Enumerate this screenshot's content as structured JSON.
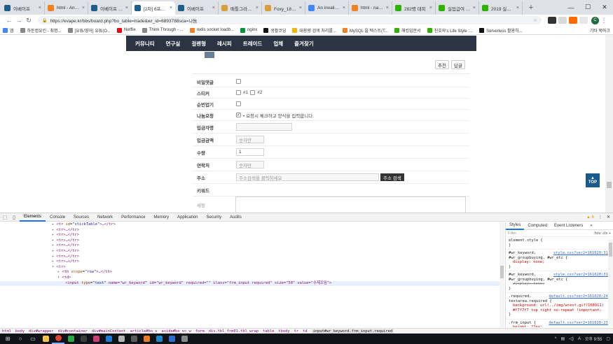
{
  "browser": {
    "tabs": [
      {
        "title": "이베이프",
        "color": "#1f5e8c",
        "active": false
      },
      {
        "title": "html - An in...",
        "color": "#f48024",
        "active": false
      },
      {
        "title": "이베이프 날...",
        "color": "#1f5e8c",
        "active": false
      },
      {
        "title": "[2차] 6프라...",
        "color": "#1f5e8c",
        "active": true
      },
      {
        "title": "이베이프",
        "color": "#1f5e8c",
        "active": false
      },
      {
        "title": "배틀그라운드",
        "color": "#d8a03c",
        "active": false
      },
      {
        "title": "Foxy_1881 의",
        "color": "#d8a03c",
        "active": false
      },
      {
        "title": "An invalid fo",
        "color": "#4285f4",
        "active": false
      },
      {
        "title": "html - name",
        "color": "#f48024",
        "active": false
      },
      {
        "title": "282명 대피",
        "color": "#2db400",
        "active": false
      },
      {
        "title": "실업급여 수...",
        "color": "#2db400",
        "active": false
      },
      {
        "title": "2019 실업급...",
        "color": "#2db400",
        "active": false
      }
    ],
    "new_tab": "+",
    "window_controls": [
      "—",
      "☐",
      "✕"
    ],
    "url": "https://evape.kr/bbs/board.php?bo_table=trade&wr_id=6893788sca=나눔",
    "profile_initial": "C",
    "bookmarks": [
      {
        "label": "앱",
        "color": "#4285f4"
      },
      {
        "label": "하둔컴유킨 - 최명...",
        "color": "#888888"
      },
      {
        "label": "[유튜/영어] 유튜(O...",
        "color": "#888888"
      },
      {
        "label": "Netflix",
        "color": "#e50914"
      },
      {
        "label": "Think Through - ...",
        "color": "#888888"
      },
      {
        "label": "redis socket loadb...",
        "color": "#f48024"
      },
      {
        "label": "nginx",
        "color": "#009639"
      },
      {
        "label": "생활코딩",
        "color": "#111111"
      },
      {
        "label": "대용량 검색 처리를...",
        "color": "#f4b400"
      },
      {
        "label": "MySQL 을 텍스트(T...",
        "color": "#f48024"
      },
      {
        "label": "해킹입문서",
        "color": "#2db400"
      },
      {
        "label": "친호와's Life Style :...",
        "color": "#2db400"
      },
      {
        "label": "Serverless 활용하...",
        "color": "#111111"
      }
    ],
    "bookmarks_other": "기타 북마크"
  },
  "site": {
    "nav": [
      "커뮤니티",
      "연구실",
      "걸렌형",
      "레시피",
      "트레이드",
      "업체",
      "즐겨찾기"
    ],
    "buttons": {
      "recommend": "추천",
      "reply": "답글"
    },
    "form": {
      "secret_comment": "비밀댓글",
      "sticker": "스티커",
      "sticker_opts": [
        "#1",
        "#2"
      ],
      "order": "순번업기",
      "share_request": "나눔요청",
      "share_note": "• 요청시 체크하고 양식을 입력합니다.",
      "depositor": "입금자명",
      "amount": "입금금액",
      "amount_ph": "숫자만",
      "qty": "수량",
      "qty_val": "1",
      "contact": "연락처",
      "contact_ph": "숫자만",
      "address": "주소",
      "address_ph": "주소검색을 클릭하세요",
      "address_btn": "주소 검색",
      "keyword": "키워드",
      "memo": "세팅"
    },
    "top_button": "TOP"
  },
  "devtools": {
    "tabs": [
      "Elements",
      "Console",
      "Sources",
      "Network",
      "Performance",
      "Memory",
      "Application",
      "Security",
      "Audits"
    ],
    "warnings": "▲ 6",
    "dom_lines": [
      {
        "indent": 4,
        "tri": "▸",
        "tag": "tr",
        "attr": "id",
        "val": "stickTable",
        "tail": ">…</tr>"
      },
      {
        "indent": 4,
        "tri": "▸",
        "tag": "tr",
        "attr": "",
        "val": "",
        "tail": ">…</tr>"
      },
      {
        "indent": 4,
        "tri": "▸",
        "tag": "tr",
        "attr": "",
        "val": "",
        "tail": ">…</tr>"
      },
      {
        "indent": 4,
        "tri": "▸",
        "tag": "tr",
        "attr": "",
        "val": "",
        "tail": ">…</tr>"
      },
      {
        "indent": 4,
        "tri": "▸",
        "tag": "tr",
        "attr": "",
        "val": "",
        "tail": ">…</tr>"
      },
      {
        "indent": 4,
        "tri": "▸",
        "tag": "tr",
        "attr": "",
        "val": "",
        "tail": ">…</tr>"
      },
      {
        "indent": 4,
        "tri": "▸",
        "tag": "tr",
        "attr": "",
        "val": "",
        "tail": ">…</tr>"
      },
      {
        "indent": 4,
        "tri": "▸",
        "tag": "tr",
        "attr": "",
        "val": "",
        "tail": ">…</tr>"
      },
      {
        "indent": 4,
        "tri": "▾",
        "tag": "tr",
        "attr": "",
        "val": "",
        "tail": ">"
      },
      {
        "indent": 6,
        "tri": "▸",
        "tag": "th",
        "attr": "scope",
        "val": "row",
        "tail": ">…</th>"
      },
      {
        "indent": 6,
        "tri": "▾",
        "tag": "td",
        "attr": "",
        "val": "",
        "tail": ">"
      },
      {
        "indent": 8,
        "tri": "",
        "tag": "input",
        "attr": "type",
        "val": "text",
        "tail": " name=\"wr_keyword\" id=\"wr_keyword\" required=\"\" class=\"frm_input required\" size=\"50\" value=\"수제꼬임\">"
      }
    ],
    "styles_tabs": [
      "Styles",
      "Computed",
      "Event Listeners",
      "»"
    ],
    "filter": "Filter",
    "filter_right": ":hov .cls +",
    "rules": [
      {
        "sel": "element.style {",
        "src": "",
        "props": [],
        "close": "}"
      },
      {
        "sel": "#wr_keyword, #wr_groupbuying, #wr_etc {",
        "src": "style.css?ver2=161020:316",
        "props": [
          {
            "t": "display: none;",
            "s": false
          }
        ],
        "close": "}"
      },
      {
        "sel": "#wr_keyword, #wr_groupbuying, #wr_etc {",
        "src": "style.css?ver2=161020:314",
        "props": [
          {
            "t": "display: none;",
            "s": true
          }
        ],
        "close": "}"
      },
      {
        "sel": ".required, textarea.required {",
        "src": "default.css?ver2=161020:243",
        "props": [
          {
            "t": "background: url(../img/wrest.gif?168911) #f7f7f7 top right no-repeat !important;",
            "s": false
          }
        ],
        "close": "}"
      },
      {
        "sel": ".frm_input {",
        "src": "default.css?ver2=161020:238",
        "props": [
          {
            "t": "height: 22px;",
            "s": false
          }
        ],
        "close": ""
      }
    ],
    "breadcrumbs": [
      "html",
      "body",
      "div#wrapper",
      "div#container",
      "div#mainContent",
      "article#bo_v",
      "aside#bo_vc_w",
      "form",
      "div.tbl_frm01.tbl_wrap",
      "table",
      "tbody",
      "tr",
      "td",
      "input#wr_keyword.frm_input.required"
    ]
  },
  "taskbar": {
    "tray_lang": "A",
    "tray_time": "오후 9:55"
  }
}
